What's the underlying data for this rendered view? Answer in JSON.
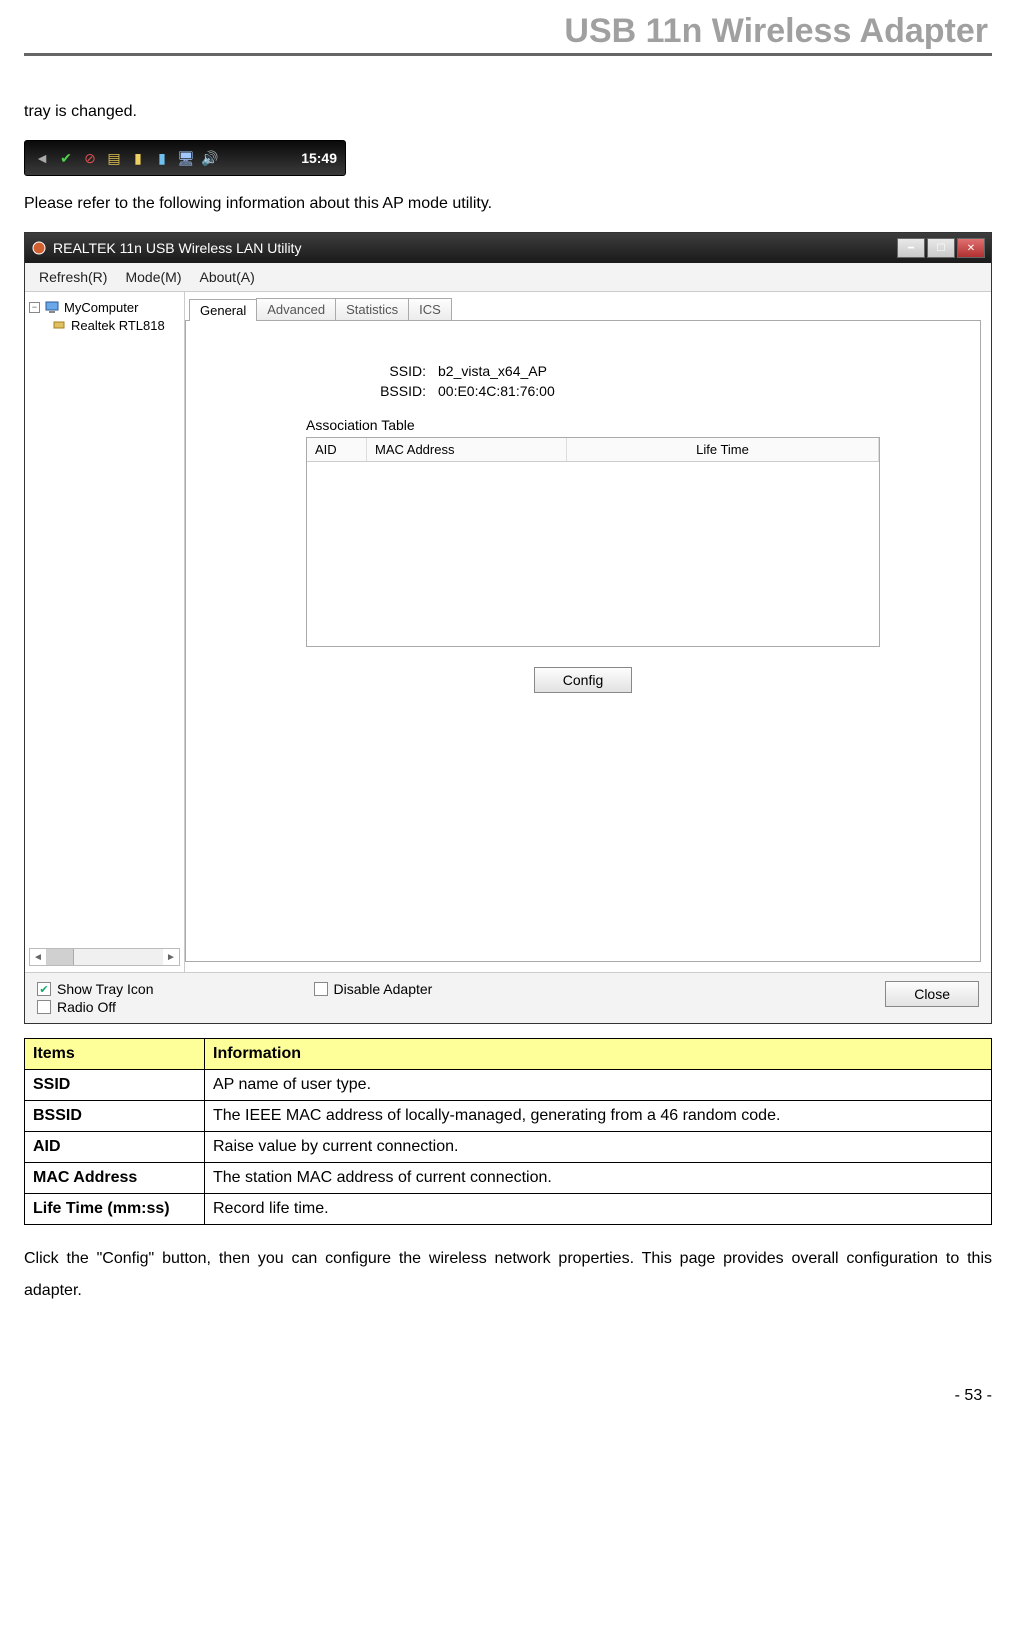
{
  "doc_title": "USB 11n Wireless Adapter",
  "para1": "tray is changed.",
  "para2": "Please refer to the following information about this AP mode utility.",
  "para3": "Click the \"Config\" button, then you can configure the wireless network properties. This page provides overall configuration to this adapter.",
  "page_num": "- 53 -",
  "systray": {
    "clock": "15:49"
  },
  "app": {
    "title": "REALTEK 11n USB Wireless LAN Utility",
    "menu": {
      "refresh": "Refresh(R)",
      "mode": "Mode(M)",
      "about": "About(A)"
    },
    "tree": {
      "root": "MyComputer",
      "child": "Realtek RTL818"
    },
    "tabs": {
      "general": "General",
      "advanced": "Advanced",
      "statistics": "Statistics",
      "ics": "ICS"
    },
    "fields": {
      "ssid_label": "SSID:",
      "ssid_value": "b2_vista_x64_AP",
      "bssid_label": "BSSID:",
      "bssid_value": "00:E0:4C:81:76:00",
      "assoc_label": "Association Table",
      "col_aid": "AID",
      "col_mac": "MAC Address",
      "col_life": "Life Time"
    },
    "buttons": {
      "config": "Config",
      "close": "Close"
    },
    "footer": {
      "show_tray": "Show Tray Icon",
      "radio_off": "Radio Off",
      "disable_adapter": "Disable Adapter"
    }
  },
  "table": {
    "head_items": "Items",
    "head_info": "Information",
    "rows": [
      {
        "k": "SSID",
        "v": "AP name of user type."
      },
      {
        "k": "BSSID",
        "v": "The IEEE MAC address of locally-managed, generating from a 46 random code."
      },
      {
        "k": "AID",
        "v": "Raise value by current connection."
      },
      {
        "k": "MAC Address",
        "v": "The station MAC address of current connection."
      },
      {
        "k": "Life Time (mm:ss)",
        "v": "Record life time."
      }
    ]
  }
}
